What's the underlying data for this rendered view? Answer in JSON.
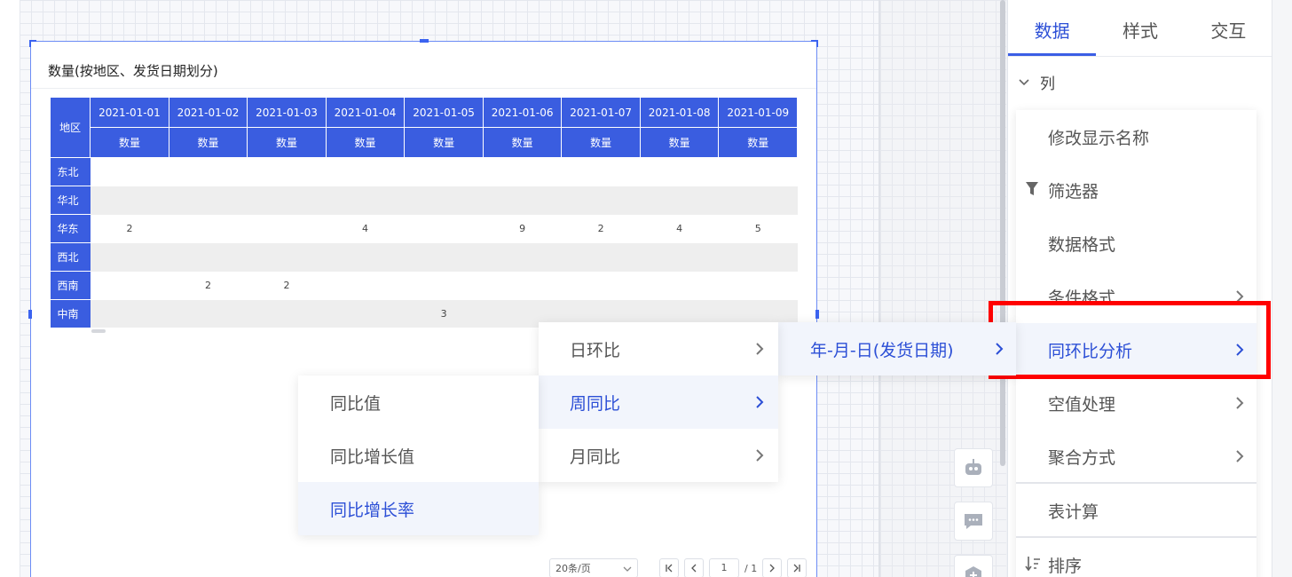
{
  "widget": {
    "title": "数量(按地区、发货日期划分)",
    "table": {
      "row_header": "地区",
      "dates": [
        "2021-01-01",
        "2021-01-02",
        "2021-01-03",
        "2021-01-04",
        "2021-01-05",
        "2021-01-06",
        "2021-01-07",
        "2021-01-08",
        "2021-01-09"
      ],
      "measure": "数量",
      "rows": [
        {
          "region": "东北",
          "values": [
            "",
            "",
            "",
            "",
            "",
            "",
            "",
            "",
            ""
          ]
        },
        {
          "region": "华北",
          "values": [
            "",
            "",
            "",
            "",
            "",
            "",
            "",
            "",
            ""
          ]
        },
        {
          "region": "华东",
          "values": [
            "2",
            "",
            "",
            "4",
            "",
            "9",
            "2",
            "4",
            "5"
          ]
        },
        {
          "region": "西北",
          "values": [
            "",
            "",
            "",
            "",
            "",
            "",
            "",
            "",
            ""
          ]
        },
        {
          "region": "西南",
          "values": [
            "",
            "2",
            "2",
            "",
            "",
            "",
            "",
            "",
            ""
          ]
        },
        {
          "region": "中南",
          "values": [
            "",
            "",
            "",
            "",
            "3",
            "",
            "",
            "",
            ""
          ]
        }
      ]
    },
    "pager": {
      "page_size": "20条/页",
      "current": "1",
      "total": "/ 1"
    }
  },
  "panel": {
    "tabs": [
      "数据",
      "样式",
      "交互"
    ],
    "active_tab": "数据",
    "section": "列"
  },
  "context_menu": {
    "items": [
      {
        "label": "修改显示名称",
        "has_sub": false
      },
      {
        "label": "筛选器",
        "has_sub": false,
        "icon": "filter-icon"
      },
      {
        "label": "数据格式",
        "has_sub": false
      },
      {
        "label": "条件格式",
        "has_sub": true
      },
      {
        "label": "同环比分析",
        "has_sub": true,
        "highlighted": true
      },
      {
        "label": "空值处理",
        "has_sub": true
      },
      {
        "label": "聚合方式",
        "has_sub": true
      },
      {
        "label": "表计算",
        "has_sub": false
      },
      {
        "label": "排序",
        "has_sub": false,
        "icon": "sort-icon"
      }
    ]
  },
  "submenu_field": {
    "label": "年-月-日(发货日期)"
  },
  "submenu_compare": {
    "items": [
      "日环比",
      "周同比",
      "月同比"
    ],
    "active": "周同比"
  },
  "submenu_value": {
    "items": [
      "同比值",
      "同比增长值",
      "同比增长率"
    ],
    "active": "同比增长率"
  },
  "colors": {
    "accent": "#3a5de0",
    "highlight_box": "#ff0000"
  }
}
